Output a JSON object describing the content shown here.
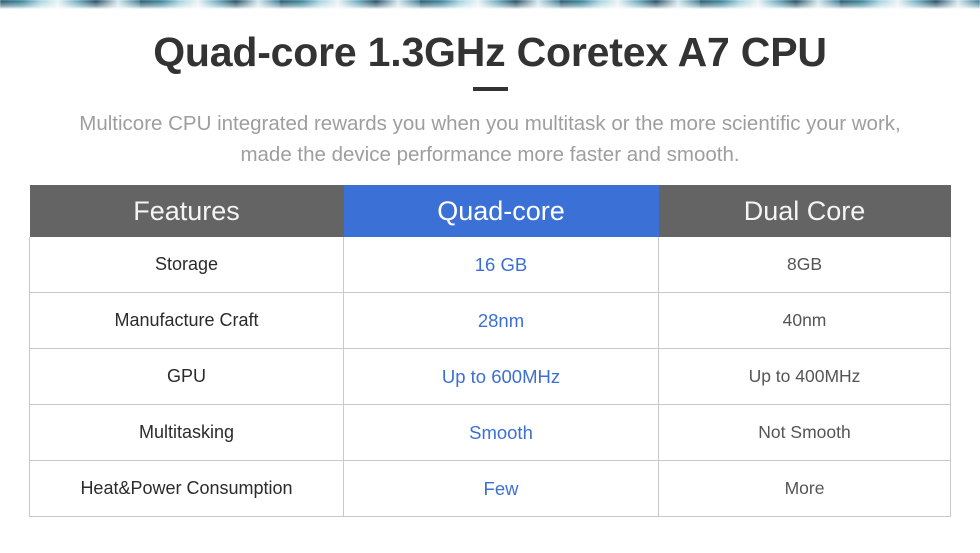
{
  "decor": {
    "top_strip_name": "top-image-strip"
  },
  "header": {
    "title": "Quad-core 1.3GHz Coretex A7 CPU",
    "subtitle_line1": "Multicore CPU integrated rewards you when you multitask or the more scientific your work,",
    "subtitle_line2": "made the device performance more faster and smooth."
  },
  "colors": {
    "title": "#333333",
    "subtitle": "#9e9e9e",
    "header_gray": "#646464",
    "header_blue": "#3b71d7",
    "highlight_text": "#3c6fd4",
    "cell_text": "#555555",
    "border": "#c9c9c9"
  },
  "table": {
    "columns": [
      {
        "label": "Features",
        "highlight": false
      },
      {
        "label": "Quad-core",
        "highlight": true
      },
      {
        "label": "Dual Core",
        "highlight": false
      }
    ],
    "rows": [
      {
        "feature": "Storage",
        "quad": "16 GB",
        "dual": "8GB"
      },
      {
        "feature": "Manufacture Craft",
        "quad": "28nm",
        "dual": "40nm"
      },
      {
        "feature": "GPU",
        "quad": "Up to 600MHz",
        "dual": "Up to 400MHz"
      },
      {
        "feature": "Multitasking",
        "quad": "Smooth",
        "dual": "Not Smooth"
      },
      {
        "feature": "Heat&Power Consumption",
        "quad": "Few",
        "dual": "More"
      }
    ]
  }
}
